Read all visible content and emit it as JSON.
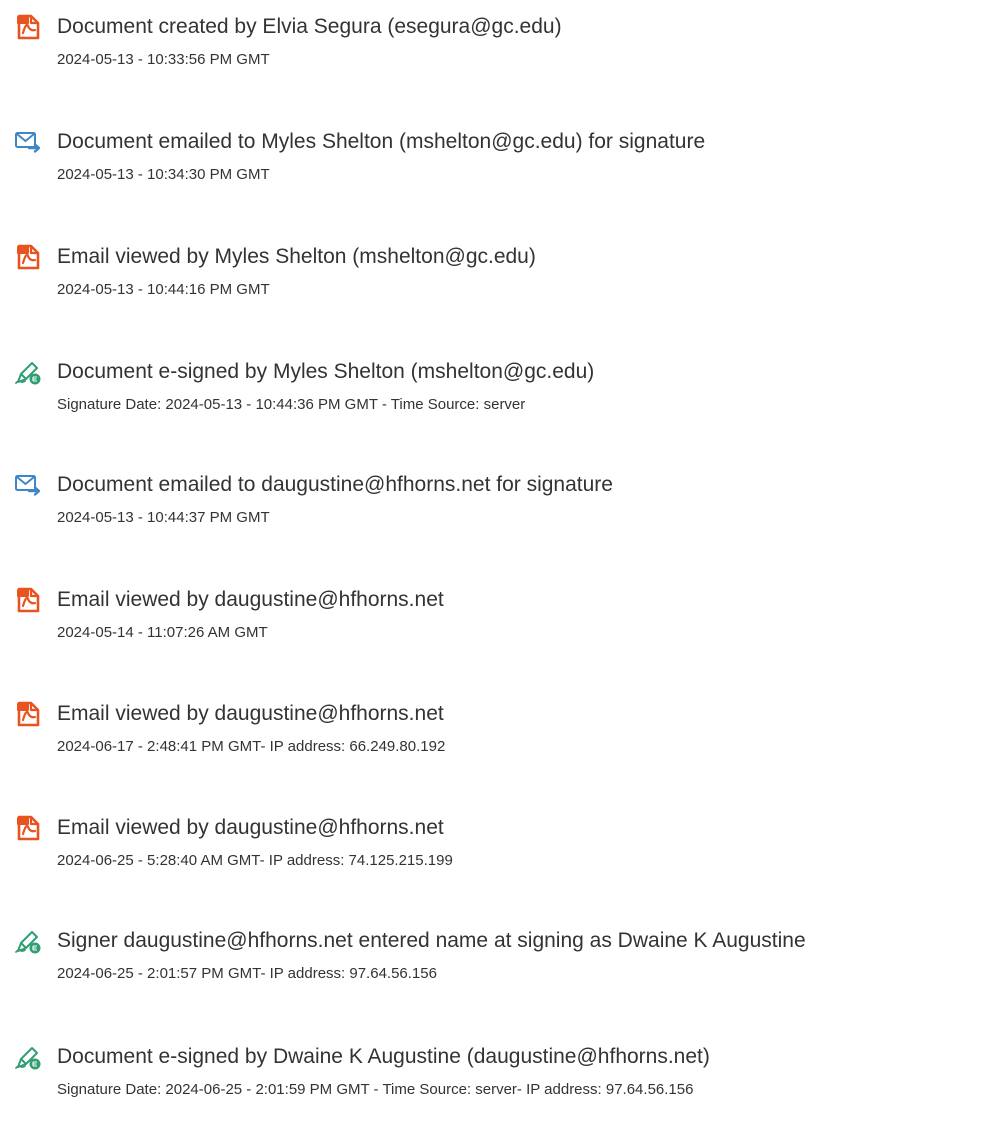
{
  "colors": {
    "pdf_icon": "#e8541f",
    "email_icon": "#3f86c9",
    "sign_icon": "#2f9e73",
    "text": "#333333"
  },
  "events": [
    {
      "icon": "document-icon",
      "title": "Document created by Elvia Segura (esegura@gc.edu)",
      "detail": "2024-05-13 - 10:33:56 PM GMT"
    },
    {
      "icon": "email-icon",
      "title": "Document emailed to Myles Shelton (mshelton@gc.edu) for signature",
      "detail": "2024-05-13 - 10:34:30 PM GMT"
    },
    {
      "icon": "document-icon",
      "title": "Email viewed by Myles Shelton (mshelton@gc.edu)",
      "detail": "2024-05-13 - 10:44:16 PM GMT"
    },
    {
      "icon": "signature-icon",
      "title": "Document e-signed by Myles Shelton (mshelton@gc.edu)",
      "detail": "Signature Date: 2024-05-13 - 10:44:36 PM GMT - Time Source: server"
    },
    {
      "icon": "email-icon",
      "title": "Document emailed to daugustine@hfhorns.net for signature",
      "detail": "2024-05-13 - 10:44:37 PM GMT"
    },
    {
      "icon": "document-icon",
      "title": "Email viewed by daugustine@hfhorns.net",
      "detail": "2024-05-14 - 11:07:26 AM GMT"
    },
    {
      "icon": "document-icon",
      "title": "Email viewed by daugustine@hfhorns.net",
      "detail": "2024-06-17 - 2:48:41 PM GMT- IP address: 66.249.80.192"
    },
    {
      "icon": "document-icon",
      "title": "Email viewed by daugustine@hfhorns.net",
      "detail": "2024-06-25 - 5:28:40 AM GMT- IP address: 74.125.215.199"
    },
    {
      "icon": "signature-icon",
      "title": "Signer daugustine@hfhorns.net entered name at signing as Dwaine K Augustine",
      "detail": "2024-06-25 - 2:01:57 PM GMT- IP address: 97.64.56.156"
    },
    {
      "icon": "signature-icon",
      "title": "Document e-signed by Dwaine K Augustine (daugustine@hfhorns.net)",
      "detail": "Signature Date: 2024-06-25 - 2:01:59 PM GMT - Time Source: server- IP address: 97.64.56.156"
    }
  ]
}
